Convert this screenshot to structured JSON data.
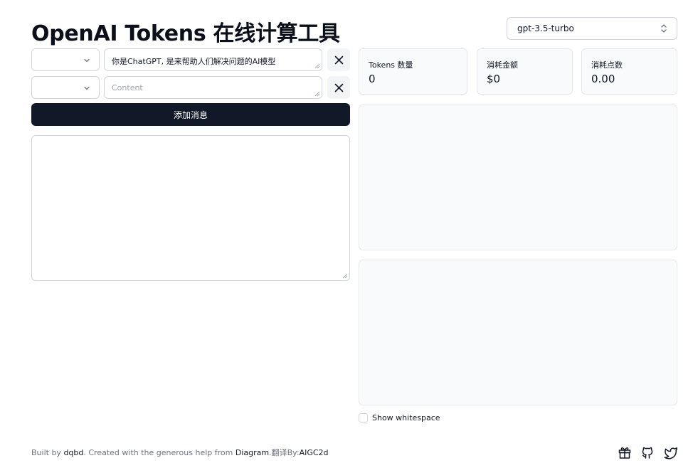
{
  "header": {
    "title": "OpenAI Tokens 在线计算工具",
    "model_select": {
      "value": "gpt-3.5-turbo",
      "icon": "chevron-updown-icon"
    }
  },
  "messages": [
    {
      "role": "",
      "content": "你是ChatGPT, 是来帮助人们解决问题的AI模型",
      "placeholder": "Content"
    },
    {
      "role": "",
      "content": "",
      "placeholder": "Content"
    }
  ],
  "add_button_label": "添加消息",
  "stats": {
    "tokens": {
      "label": "Tokens 数量",
      "value": "0"
    },
    "cost": {
      "label": "消耗金额",
      "value": "$0"
    },
    "points": {
      "label": "消耗点数",
      "value": "0.00"
    }
  },
  "show_whitespace_label": "Show whitespace",
  "footer": {
    "built_by": "Built by",
    "author": "dqbd",
    "created_text": ". Created with the generous help from",
    "helper": "Diagram",
    "dot": ".",
    "translate_text": "翻译By:",
    "translator": "AIGC2d",
    "icons": [
      "gift-icon",
      "github-icon",
      "twitter-icon"
    ]
  },
  "colors": {
    "primary_button": "#111827",
    "panel_bg": "#f9fafb",
    "border": "#d1d5db"
  }
}
